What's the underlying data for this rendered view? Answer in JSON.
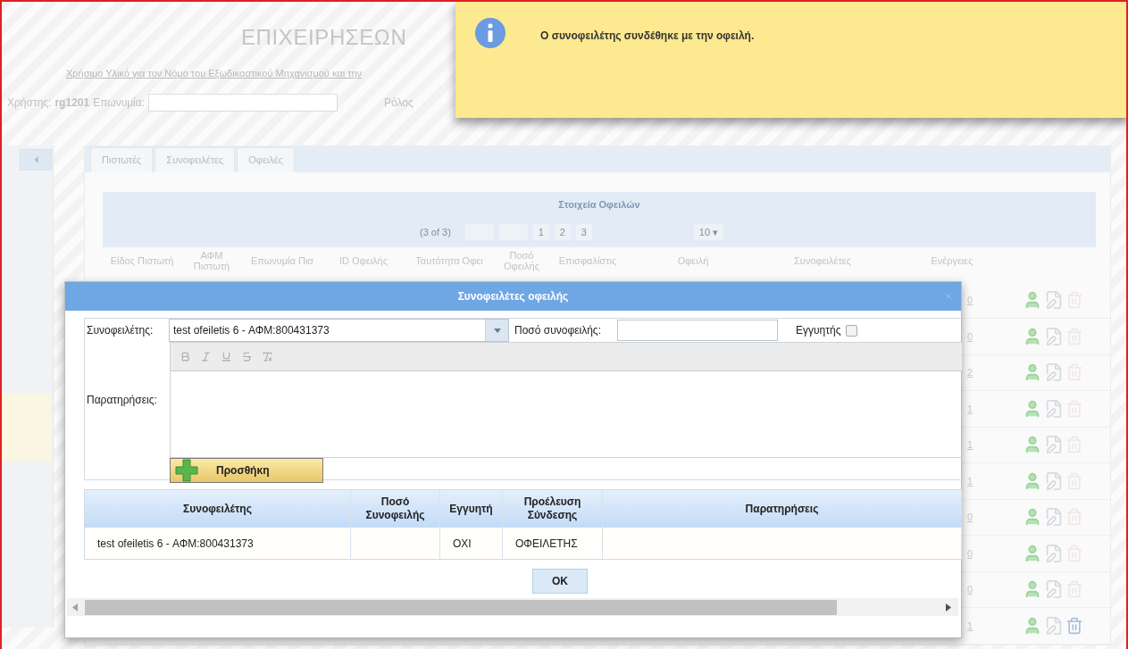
{
  "page": {
    "title": "ΕΠΙΧΕΙΡΗΣΕΩΝ",
    "link": "Χρήσιμο Υλικό για τον Νόμο του Εξωδικαστικού Μηχανισμού και την",
    "user_label": "Χρήστης:",
    "user": "rg1201",
    "name_label": "Επωνυμία:",
    "role_label": "Ρόλος"
  },
  "tabs": [
    {
      "label": "Πιστωτές"
    },
    {
      "label": "Συνοφειλέτες"
    },
    {
      "label": "Οφειλές"
    }
  ],
  "grid": {
    "title": "Στοιχεία Οφειλών",
    "page_info": "(3 of 3)",
    "pages": [
      "1",
      "2",
      "3"
    ],
    "rows_per_page": "10 ▾",
    "columns": [
      "Είδος Πιστωτή",
      "ΑΦΜ Πιστωτή",
      "Επωνυμία Πισ",
      "ID Οφειλής",
      "Ταυτότητα Οφει",
      "Ποσό Οφειλής",
      "Επισφαλίστις",
      "Οφειλή",
      "Συνοφειλέτες",
      "Ενέργειες"
    ],
    "rows": [
      {
        "coborrowers": "0",
        "deletable": false
      },
      {
        "coborrowers": "0",
        "deletable": false
      },
      {
        "coborrowers": "2",
        "deletable": false
      },
      {
        "coborrowers": "1",
        "deletable": false
      },
      {
        "coborrowers": "1",
        "deletable": false
      },
      {
        "coborrowers": "1",
        "deletable": false
      },
      {
        "coborrowers": "0",
        "deletable": false
      },
      {
        "coborrowers": "0",
        "deletable": false
      },
      {
        "coborrowers": "0",
        "deletable": false
      },
      {
        "coborrowers": "1",
        "deletable": true
      }
    ]
  },
  "dialog": {
    "title": "Συνοφειλέτες οφειλής",
    "coborrower_label": "Συνοφειλέτης:",
    "coborrower_value": "test ofeiletis 6 - ΑΦΜ:800431373",
    "amount_label": "Ποσό συνοφειλής:",
    "guarantor_label": "Εγγυητής",
    "guarantor_checked": false,
    "notes_label": "Παρατηρήσεις:",
    "add_button": "Προσθήκη",
    "table": {
      "columns": [
        "Συνοφειλέτης",
        "Ποσό Συνοφειλής",
        "Εγγυητή",
        "Προέλευση Σύνδεσης",
        "Παρατηρήσεις"
      ],
      "rows": [
        [
          "test ofeiletis 6 - ΑΦΜ:800431373",
          "",
          "ΟΧΙ",
          "ΟΦΕΙΛΕΤΗΣ",
          ""
        ]
      ]
    },
    "ok_button": "OK"
  },
  "notification": {
    "message": "Ο συνοφειλέτης συνδέθηκε με την οφειλή."
  }
}
